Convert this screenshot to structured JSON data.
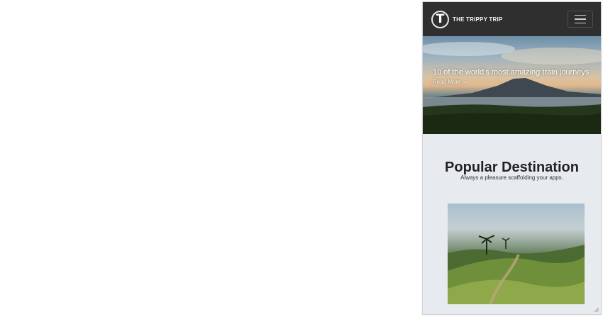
{
  "navbar": {
    "logo_letter": "T",
    "brand_name": "THE TRIPPY TRIP",
    "menu_icon": "hamburger-icon"
  },
  "hero": {
    "caption": "10 of the world's most amazing train journeys",
    "subcaption": "Read More →"
  },
  "section": {
    "title": "Popular Destination",
    "subtitle": "Always a pleasure scaffolding your apps."
  },
  "colors": {
    "navbar_bg": "#2f2f2f",
    "page_bg": "#e7ebef"
  }
}
